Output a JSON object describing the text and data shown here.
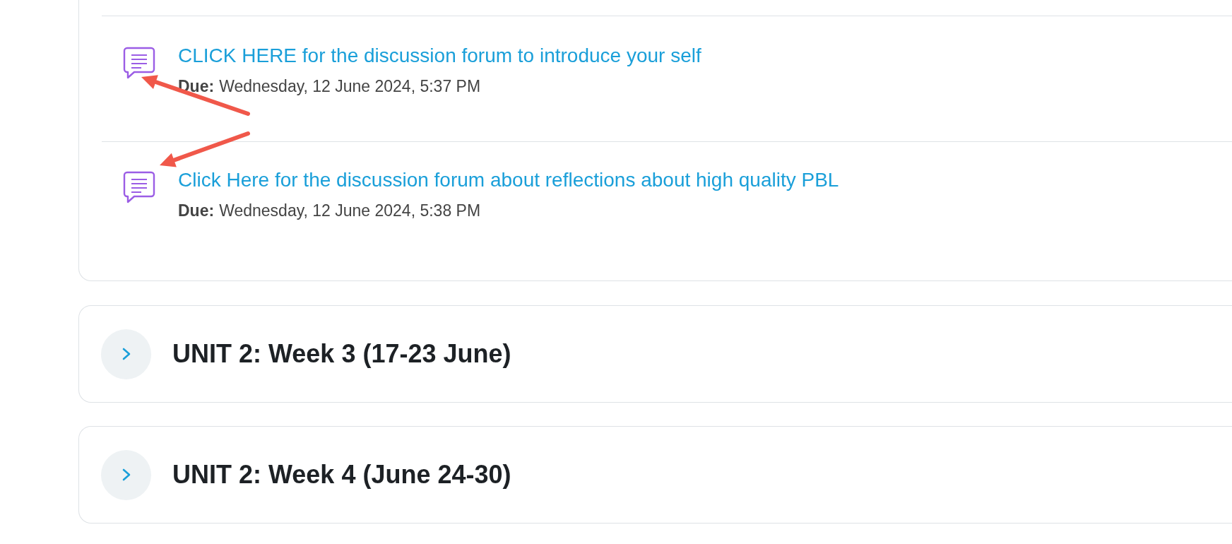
{
  "activities": [
    {
      "title": "CLICK HERE for the discussion forum to introduce your self",
      "due_label": "Due:",
      "due_date": "Wednesday, 12 June 2024, 5:37 PM"
    },
    {
      "title": "Click Here for the discussion forum about reflections about high quality PBL",
      "due_label": "Due:",
      "due_date": "Wednesday, 12 June 2024, 5:38 PM"
    }
  ],
  "sections": [
    {
      "title": "UNIT 2: Week 3 (17-23 June)",
      "expanded": false
    },
    {
      "title": "UNIT 2: Week 4 (June 24-30)",
      "expanded": false
    }
  ],
  "annotations": [
    {
      "kind": "arrow"
    },
    {
      "kind": "arrow"
    }
  ]
}
